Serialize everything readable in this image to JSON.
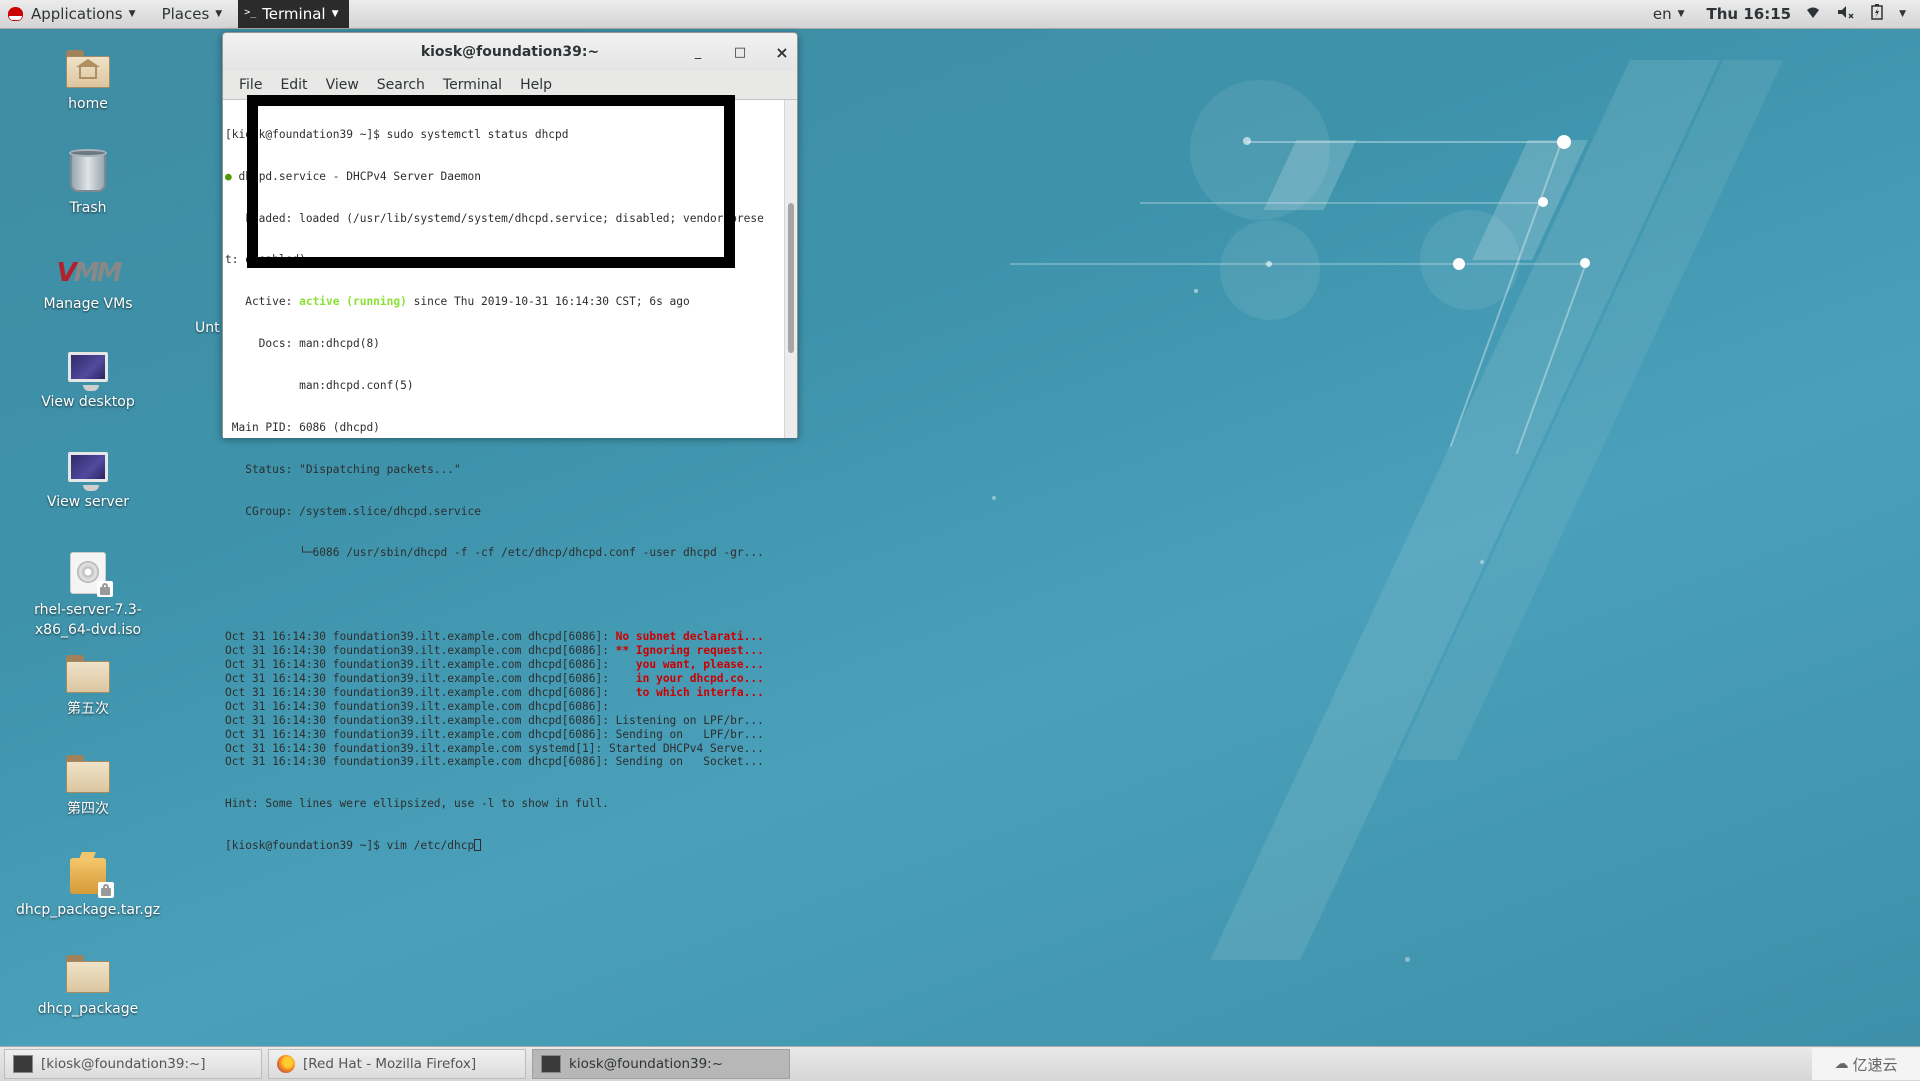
{
  "topbar": {
    "applications_label": "Applications",
    "places_label": "Places",
    "active_app_label": "Terminal",
    "language": "en",
    "clock": "Thu 16:15",
    "icons": [
      "wifi-icon",
      "volume-muted-icon",
      "battery-charging-icon",
      "system-menu-arrow-icon"
    ]
  },
  "desktop": {
    "icons": [
      {
        "label": "home",
        "icon": "home-folder-icon"
      },
      {
        "label": "Trash",
        "icon": "trash-icon"
      },
      {
        "label": "Manage VMs",
        "icon": "vm-manager-icon"
      },
      {
        "label": "View desktop",
        "icon": "monitor-icon"
      },
      {
        "label": "View server",
        "icon": "monitor-icon"
      },
      {
        "label": "rhel-server-7.3-x86_64-dvd.iso",
        "label_line1": "rhel-server-7.3-",
        "label_line2": "x86_64-dvd.iso",
        "icon": "disc-image-icon"
      },
      {
        "label": "第五次",
        "icon": "folder-icon"
      },
      {
        "label": "第四次",
        "icon": "folder-icon"
      },
      {
        "label": "dhcp_package.tar.gz",
        "icon": "archive-icon"
      },
      {
        "label": "dhcp_package",
        "icon": "folder-icon"
      }
    ],
    "partial_label": "Unt"
  },
  "terminal": {
    "title": "kiosk@foundation39:~",
    "window_buttons": {
      "minimize": "_",
      "maximize": "□",
      "close": "×"
    },
    "menu": [
      "File",
      "Edit",
      "View",
      "Search",
      "Terminal",
      "Help"
    ],
    "lines": {
      "l1": "[kiosk@foundation39 ~]$ sudo systemctl status dhcpd",
      "l2_bullet": "●",
      "l2": " dhcpd.service - DHCPv4 Server Daemon",
      "l3": "   Loaded: loaded (/usr/lib/systemd/system/dhcpd.service; disabled; vendor prese",
      "l4": "t: disabled)",
      "l5_pre": "   Active: ",
      "l5_status": "active (running)",
      "l5_post": " since Thu 2019-10-31 16:14:30 CST; 6s ago",
      "l6": "     Docs: man:dhcpd(8)",
      "l7": "           man:dhcpd.conf(5)",
      "l8": " Main PID: 6086 (dhcpd)",
      "l9": "   Status: \"Dispatching packets...\"",
      "l10": "   CGroup: /system.slice/dhcpd.service",
      "l11": "           └─6086 /usr/sbin/dhcpd -f -cf /etc/dhcp/dhcpd.conf -user dhcpd -gr...",
      "l12": ""
    },
    "log_prefix": "Oct 31 16:14:30 foundation39.ilt.example.com ",
    "log": [
      {
        "src": "dhcpd[6086]: ",
        "msg": "No subnet declarati...",
        "error": true
      },
      {
        "src": "dhcpd[6086]: ",
        "msg": "** Ignoring request...",
        "error": true
      },
      {
        "src": "dhcpd[6086]: ",
        "msg": "   you want, please...",
        "error": true
      },
      {
        "src": "dhcpd[6086]: ",
        "msg": "   in your dhcpd.co...",
        "error": true
      },
      {
        "src": "dhcpd[6086]: ",
        "msg": "   to which interfa...",
        "error": true
      },
      {
        "src": "dhcpd[6086]: ",
        "msg": "",
        "error": false
      },
      {
        "src": "dhcpd[6086]: ",
        "msg": "Listening on LPF/br...",
        "error": false
      },
      {
        "src": "dhcpd[6086]: ",
        "msg": "Sending on   LPF/br...",
        "error": false
      },
      {
        "src": "systemd[1]: ",
        "msg": "Started DHCPv4 Serve...",
        "error": false
      },
      {
        "src": "dhcpd[6086]: ",
        "msg": "Sending on   Socket...",
        "error": false
      }
    ],
    "hint": "Hint: Some lines were ellipsized, use -l to show in full.",
    "prompt": "[kiosk@foundation39 ~]$ ",
    "current_input": "vim /etc/dhcp",
    "scroll_position": 0.55
  },
  "taskbar": {
    "tasks": [
      {
        "label": "[kiosk@foundation39:~]",
        "icon": "terminal-icon",
        "active": false
      },
      {
        "label": "[Red Hat - Mozilla Firefox]",
        "icon": "firefox-icon",
        "active": false
      },
      {
        "label": "kiosk@foundation39:~",
        "icon": "terminal-icon",
        "active": true
      }
    ],
    "watermark": "亿速云"
  }
}
